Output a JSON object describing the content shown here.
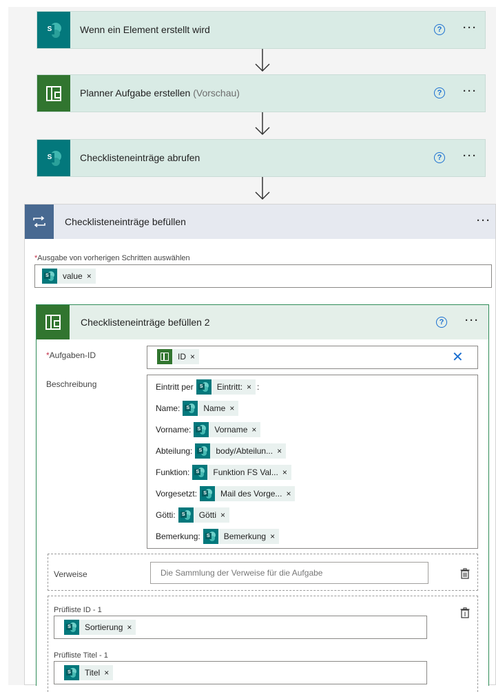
{
  "steps": [
    {
      "title": "Wenn ein Element erstellt wird",
      "subtitle": "",
      "icon": "sharepoint-icon"
    },
    {
      "title": "Planner Aufgabe erstellen",
      "subtitle": " (Vorschau)",
      "icon": "planner-icon"
    },
    {
      "title": "Checklisteneinträge abrufen",
      "subtitle": "",
      "icon": "sharepoint-icon"
    }
  ],
  "help_glyph": "?",
  "more_glyph": "···",
  "loop": {
    "title": "Checklisteneinträge befüllen",
    "icon": "loop-icon",
    "output_label": "Ausgabe von vorherigen Schritten auswählen",
    "output_token": "value"
  },
  "inner": {
    "title": "Checklisteneinträge befüllen 2",
    "task_id_label": "Aufgaben-ID",
    "task_id_token": "ID",
    "description_label": "Beschreibung",
    "description_lines": [
      {
        "label": "Eintritt per",
        "token": "Eintritt:",
        "suffix": ":"
      },
      {
        "label": "Name:",
        "token": "Name",
        "suffix": ""
      },
      {
        "label": "Vorname:",
        "token": "Vorname",
        "suffix": ""
      },
      {
        "label": "Abteilung:",
        "token": "body/Abteilun...",
        "suffix": ""
      },
      {
        "label": "Funktion:",
        "token": "Funktion FS Val...",
        "suffix": ""
      },
      {
        "label": "Vorgesetzt:",
        "token": "Mail des Vorge...",
        "suffix": ""
      },
      {
        "label": "Götti:",
        "token": "Götti",
        "suffix": ""
      },
      {
        "label": "Bemerkung:",
        "token": "Bemerkung",
        "suffix": ""
      }
    ],
    "references_label": "Verweise",
    "references_placeholder": "Die Sammlung der Verweise für die Aufgabe",
    "checklist_id_label": "Prüfliste ID - 1",
    "checklist_id_token": "Sortierung",
    "checklist_title_label": "Prüfliste Titel - 1",
    "checklist_title_token": "Titel"
  },
  "token_remove_glyph": "×",
  "colors": {
    "step_bg": "#d9ebe5",
    "sharepoint": "#03787c",
    "planner": "#31752f",
    "loop": "#486991",
    "help_blue": "#1a6fd1"
  }
}
